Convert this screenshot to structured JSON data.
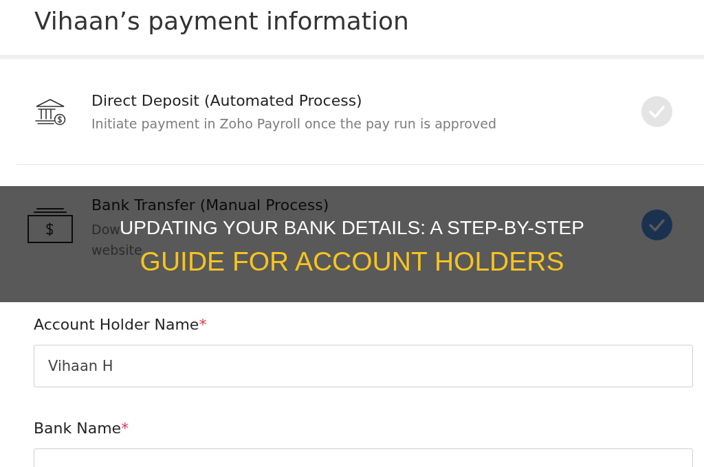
{
  "page": {
    "title": "Vihaan’s payment information"
  },
  "payment_methods": [
    {
      "kind": "deposit",
      "title": "Direct Deposit (Automated Process)",
      "description_lines": [
        "Initiate payment in Zoho Payroll once the pay run is approved"
      ],
      "selected": false
    },
    {
      "kind": "transfer",
      "title": "Bank Transfer (Manual Process)",
      "description_lines": [
        "Dow",
        "website"
      ],
      "selected": true
    }
  ],
  "form_fields": [
    {
      "label": "Account Holder Name",
      "required_mark": "*",
      "value": "Vihaan H"
    },
    {
      "label": "Bank Name",
      "required_mark": "*"
    }
  ],
  "overlay_banner": {
    "headline": "UPDATING YOUR BANK DETAILS: A STEP-BY-STEP",
    "subheadline": "GUIDE FOR ACCOUNT HOLDERS"
  }
}
